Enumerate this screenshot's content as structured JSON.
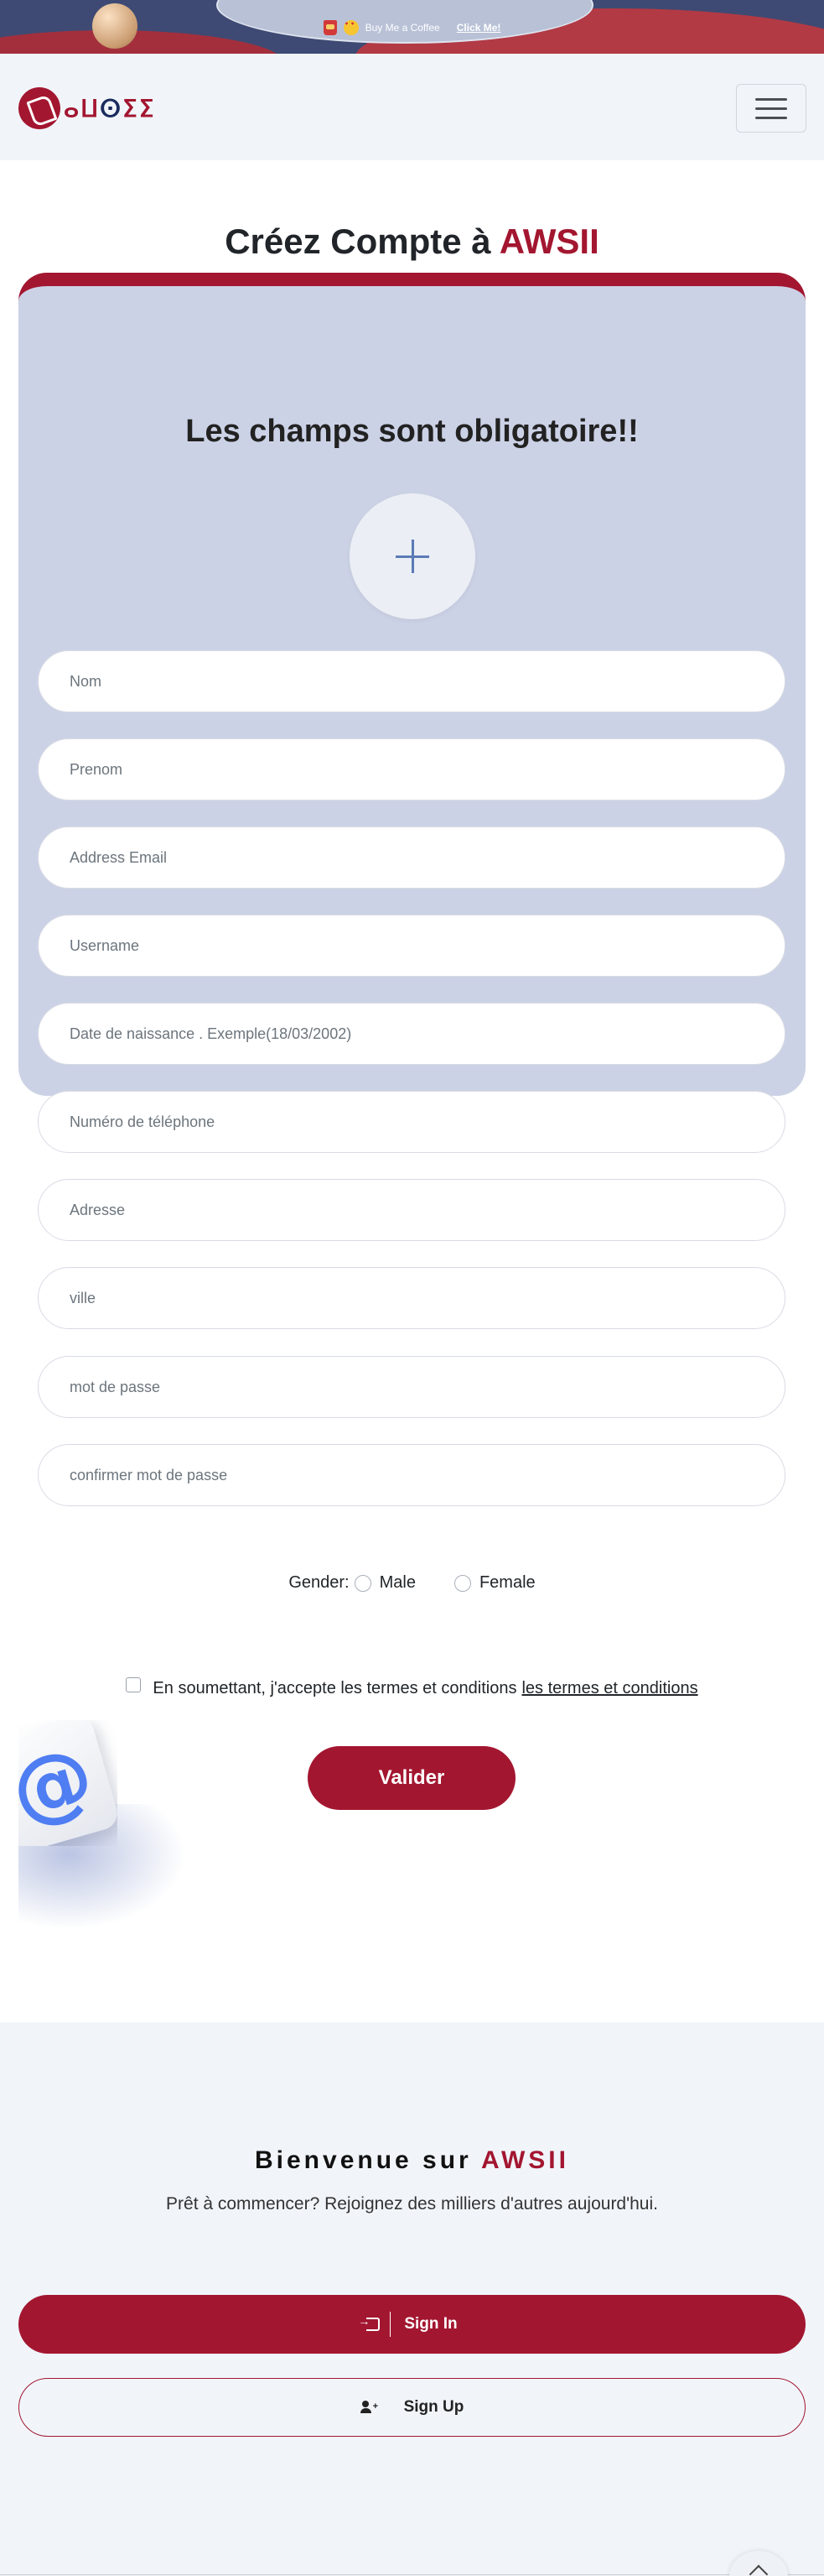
{
  "promo": {
    "text": "Buy Me a Coffee",
    "link": "Click Me!"
  },
  "header": {
    "logo_text": "AWSII"
  },
  "page": {
    "title_prefix": "Créez Compte à ",
    "title_accent": "AWSII"
  },
  "form": {
    "heading": "Les champs sont obligatoire!!",
    "fields": [
      {
        "placeholder": "Nom"
      },
      {
        "placeholder": "Prenom"
      },
      {
        "placeholder": "Address Email"
      },
      {
        "placeholder": "Username"
      },
      {
        "placeholder": "Date de naissance . Exemple(18/03/2002)"
      },
      {
        "placeholder": "Numéro de téléphone"
      },
      {
        "placeholder": "Adresse"
      },
      {
        "placeholder": "ville"
      },
      {
        "placeholder": "mot de passe"
      },
      {
        "placeholder": "confirmer mot de passe"
      }
    ],
    "gender_label": "Gender:",
    "gender_options": [
      "Male",
      "Female"
    ],
    "terms_text": "En soumettant, j'accepte les termes et conditions",
    "terms_link": "les termes et conditions",
    "submit_label": "Valider"
  },
  "welcome": {
    "title_prefix": "Bienvenue sur ",
    "title_accent": "AWSII",
    "subtitle": "Prêt à commencer? Rejoignez des milliers d'autres aujourd'hui.",
    "signin_label": "Sign In",
    "signup_label": "Sign Up"
  },
  "colors": {
    "brand": "#a31630",
    "card_bg": "#ccd2e6",
    "section_bg": "#f1f5fa"
  }
}
